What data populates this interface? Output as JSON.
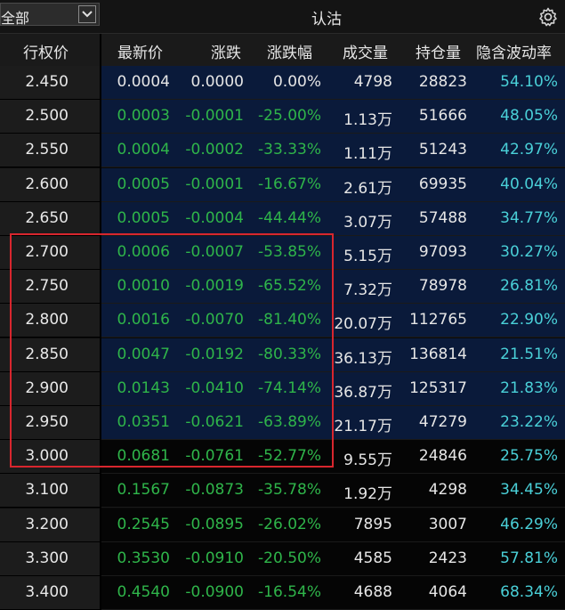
{
  "toolbar": {
    "scope_label": "全部",
    "title": "认沽",
    "settings_icon": "gear-icon"
  },
  "columns": {
    "strike": "行权价",
    "last": "最新价",
    "change": "涨跌",
    "change_pct": "涨跌幅",
    "volume": "成交量",
    "open_interest": "持仓量",
    "iv": "隐含波动率"
  },
  "colors": {
    "up": "#2fb54a",
    "iv": "#4ad0d8",
    "highlight": "#d8262e"
  },
  "rows": [
    {
      "strike": "2.450",
      "last": "0.0004",
      "change": "0.0000",
      "change_pct": "0.00%",
      "volume": "4798",
      "oi": "28823",
      "iv": "54.10%",
      "itm": true
    },
    {
      "strike": "2.500",
      "last": "0.0003",
      "change": "-0.0001",
      "change_pct": "-25.00%",
      "volume": "1.13万",
      "oi": "51666",
      "iv": "48.05%",
      "itm": true
    },
    {
      "strike": "2.550",
      "last": "0.0004",
      "change": "-0.0002",
      "change_pct": "-33.33%",
      "volume": "1.11万",
      "oi": "51243",
      "iv": "42.97%",
      "itm": true
    },
    {
      "strike": "2.600",
      "last": "0.0005",
      "change": "-0.0001",
      "change_pct": "-16.67%",
      "volume": "2.61万",
      "oi": "69935",
      "iv": "40.04%",
      "itm": true
    },
    {
      "strike": "2.650",
      "last": "0.0005",
      "change": "-0.0004",
      "change_pct": "-44.44%",
      "volume": "3.07万",
      "oi": "57488",
      "iv": "34.77%",
      "itm": true
    },
    {
      "strike": "2.700",
      "last": "0.0006",
      "change": "-0.0007",
      "change_pct": "-53.85%",
      "volume": "5.15万",
      "oi": "97093",
      "iv": "30.27%",
      "itm": true
    },
    {
      "strike": "2.750",
      "last": "0.0010",
      "change": "-0.0019",
      "change_pct": "-65.52%",
      "volume": "7.32万",
      "oi": "78978",
      "iv": "26.81%",
      "itm": true
    },
    {
      "strike": "2.800",
      "last": "0.0016",
      "change": "-0.0070",
      "change_pct": "-81.40%",
      "volume": "20.07万",
      "oi": "112765",
      "iv": "22.90%",
      "itm": true
    },
    {
      "strike": "2.850",
      "last": "0.0047",
      "change": "-0.0192",
      "change_pct": "-80.33%",
      "volume": "36.13万",
      "oi": "136814",
      "iv": "21.51%",
      "itm": true
    },
    {
      "strike": "2.900",
      "last": "0.0143",
      "change": "-0.0410",
      "change_pct": "-74.14%",
      "volume": "36.87万",
      "oi": "125317",
      "iv": "21.83%",
      "itm": true
    },
    {
      "strike": "2.950",
      "last": "0.0351",
      "change": "-0.0621",
      "change_pct": "-63.89%",
      "volume": "21.17万",
      "oi": "47279",
      "iv": "23.22%",
      "itm": true
    },
    {
      "strike": "3.000",
      "last": "0.0681",
      "change": "-0.0761",
      "change_pct": "-52.77%",
      "volume": "9.55万",
      "oi": "24846",
      "iv": "25.75%",
      "itm": false
    },
    {
      "strike": "3.100",
      "last": "0.1567",
      "change": "-0.0873",
      "change_pct": "-35.78%",
      "volume": "1.92万",
      "oi": "4298",
      "iv": "34.45%",
      "itm": false
    },
    {
      "strike": "3.200",
      "last": "0.2545",
      "change": "-0.0895",
      "change_pct": "-26.02%",
      "volume": "7895",
      "oi": "3007",
      "iv": "46.29%",
      "itm": false
    },
    {
      "strike": "3.300",
      "last": "0.3530",
      "change": "-0.0910",
      "change_pct": "-20.50%",
      "volume": "4585",
      "oi": "2423",
      "iv": "57.81%",
      "itm": false
    },
    {
      "strike": "3.400",
      "last": "0.4540",
      "change": "-0.0900",
      "change_pct": "-16.54%",
      "volume": "4688",
      "oi": "4064",
      "iv": "68.34%",
      "itm": false
    }
  ]
}
